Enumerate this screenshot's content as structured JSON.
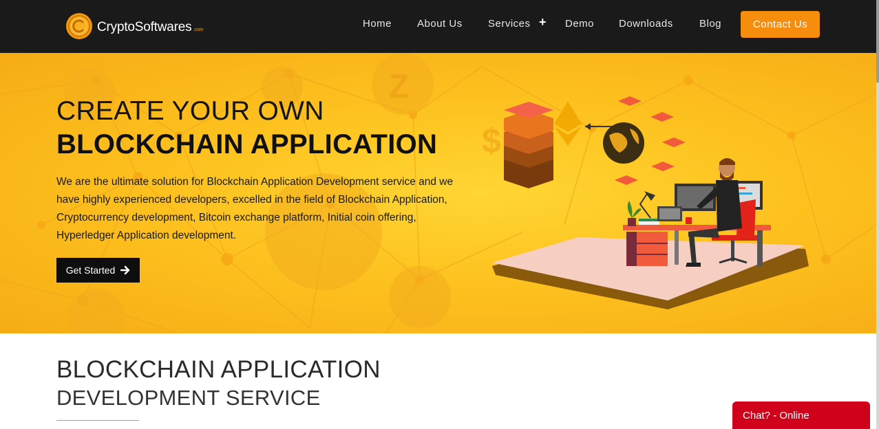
{
  "header": {
    "logo_text": "CryptoSoftwares",
    "logo_sub": ".com",
    "nav": [
      {
        "label": "Home"
      },
      {
        "label": "About Us"
      },
      {
        "label": "Services"
      },
      {
        "label": "Demo"
      },
      {
        "label": "Downloads"
      },
      {
        "label": "Blog"
      }
    ],
    "services_expand": "+",
    "contact_label": "Contact Us"
  },
  "hero": {
    "title_line1": "CREATE YOUR OWN",
    "title_line2": "BLOCKCHAIN APPLICATION",
    "description": "We are the ultimate solution for Blockchain Application Development service and we have highly experienced developers, excelled in the field of Blockchain Application, Cryptocurrency development, Bitcoin exchange platform, Initial coin offering, Hyperledger Application development.",
    "cta_label": "Get Started",
    "cta_icon": "arrow-right-icon"
  },
  "section": {
    "title_line1": "BLOCKCHAIN APPLICATION",
    "title_line2": "DEVELOPMENT SERVICE"
  },
  "chat": {
    "label": "Chat? - Online"
  },
  "colors": {
    "header_bg": "#1a1a1a",
    "accent": "#f78d0c",
    "hero_yellow": "#fdc21f",
    "chat_red": "#d0021b"
  }
}
